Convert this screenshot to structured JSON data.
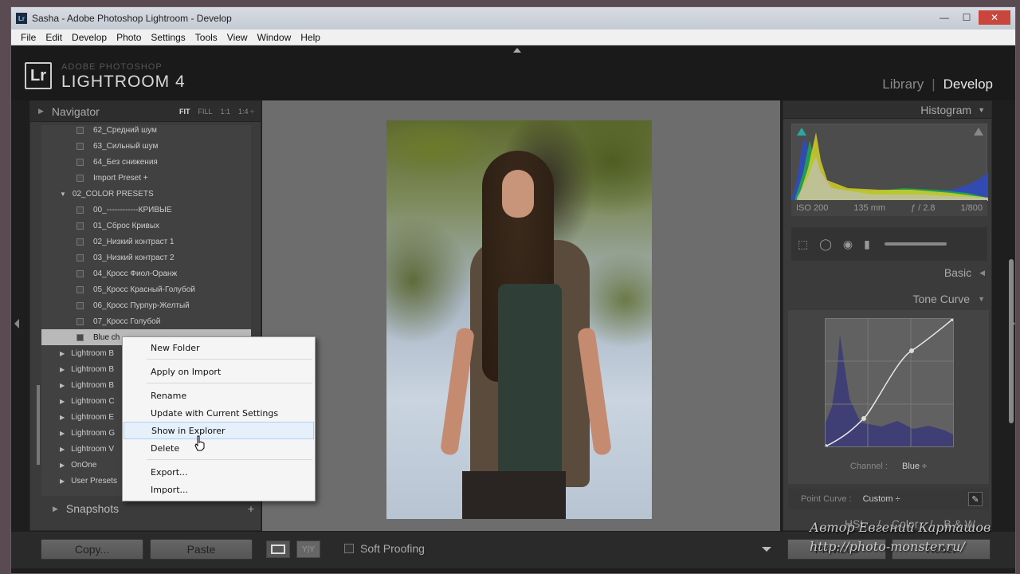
{
  "titlebar": {
    "title": "Sasha - Adobe Photoshop Lightroom - Develop",
    "app_icon": "Lr"
  },
  "menubar": [
    "File",
    "Edit",
    "Develop",
    "Photo",
    "Settings",
    "Tools",
    "View",
    "Window",
    "Help"
  ],
  "header": {
    "logo": "Lr",
    "brand_small": "ADOBE PHOTOSHOP",
    "brand_big": "LIGHTROOM 4",
    "modules": {
      "library": "Library",
      "sep": "|",
      "develop": "Develop"
    }
  },
  "left": {
    "navigator": {
      "title": "Navigator",
      "zoom": [
        "FIT",
        "FILL",
        "1:1",
        "1:4 ÷"
      ]
    },
    "presets": [
      {
        "label": "62_Средний шум",
        "type": "preset"
      },
      {
        "label": "63_Сильный шум",
        "type": "preset"
      },
      {
        "label": "64_Без снижения",
        "type": "preset"
      },
      {
        "label": "Import Preset  +",
        "type": "preset"
      },
      {
        "label": "02_COLOR PRESETS",
        "type": "folder-open"
      },
      {
        "label": "00_------------КРИВЫЕ",
        "type": "preset"
      },
      {
        "label": "01_Сброс Кривых",
        "type": "preset"
      },
      {
        "label": "02_Низкий контраст 1",
        "type": "preset"
      },
      {
        "label": "03_Низкий контраст 2",
        "type": "preset"
      },
      {
        "label": "04_Кросс Фиол-Оранж",
        "type": "preset"
      },
      {
        "label": "05_Кросс Красный-Голубой",
        "type": "preset"
      },
      {
        "label": "06_Кросс Пурпур-Желтый",
        "type": "preset"
      },
      {
        "label": "07_Кросс Голубой",
        "type": "preset"
      },
      {
        "label": "Blue ch",
        "type": "preset-selected"
      },
      {
        "label": "Lightroom B",
        "type": "folder"
      },
      {
        "label": "Lightroom B",
        "type": "folder"
      },
      {
        "label": "Lightroom B",
        "type": "folder"
      },
      {
        "label": "Lightroom C",
        "type": "folder"
      },
      {
        "label": "Lightroom E",
        "type": "folder"
      },
      {
        "label": "Lightroom G",
        "type": "folder"
      },
      {
        "label": "Lightroom V",
        "type": "folder"
      },
      {
        "label": "OnOne",
        "type": "folder"
      },
      {
        "label": "User Presets",
        "type": "folder"
      }
    ],
    "snapshots": {
      "title": "Snapshots",
      "add": "+"
    }
  },
  "context_menu": {
    "items": [
      "New Folder",
      "Apply on Import",
      "Rename",
      "Update with Current Settings",
      "Show in Explorer",
      "Delete",
      "Export...",
      "Import..."
    ],
    "hovered": "Show in Explorer"
  },
  "right": {
    "histogram": {
      "title": "Histogram",
      "iso": "ISO 200",
      "focal": "135 mm",
      "aperture": "ƒ / 2.8",
      "shutter": "1/800"
    },
    "basic": "Basic",
    "tone_curve": {
      "title": "Tone Curve",
      "channel_label": "Channel :",
      "channel_value": "Blue ÷",
      "point_curve_label": "Point Curve :",
      "point_curve_value": "Custom ÷"
    },
    "hsl_tabs": [
      "HSL",
      "/",
      "Color",
      "/",
      "B & W"
    ]
  },
  "bottom": {
    "copy": "Copy...",
    "paste": "Paste",
    "view_compare": "Y|Y",
    "soft_proofing": "Soft Proofing",
    "previous": "Previous",
    "reset": "Reset"
  },
  "watermark": {
    "line1": "Автор Евгений Карташов",
    "line2": "http://photo-monster.ru/"
  }
}
